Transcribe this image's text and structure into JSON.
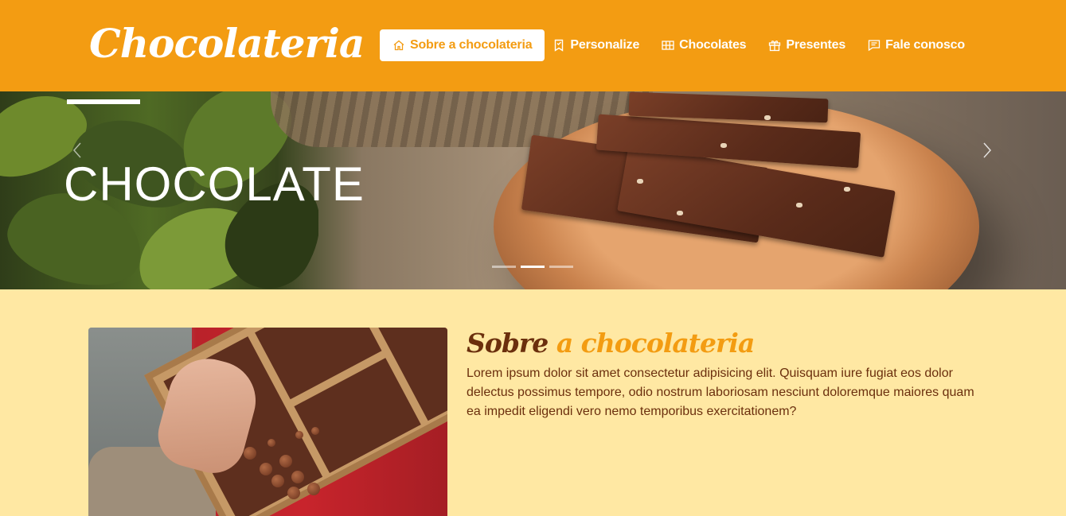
{
  "brand": {
    "logo": "Chocolateria"
  },
  "nav": {
    "items": [
      {
        "label": "Sobre a chocolateria",
        "icon": "home-icon",
        "active": true
      },
      {
        "label": "Personalize",
        "icon": "bookmark-icon",
        "active": false
      },
      {
        "label": "Chocolates",
        "icon": "grid-icon",
        "active": false
      },
      {
        "label": "Presentes",
        "icon": "gift-icon",
        "active": false
      },
      {
        "label": "Fale conosco",
        "icon": "chat-icon",
        "active": false
      }
    ]
  },
  "hero": {
    "title": "CHOCOLATE",
    "slides": 3,
    "active_slide": 2,
    "prev_icon": "chevron-left-icon",
    "next_icon": "chevron-right-icon"
  },
  "about": {
    "title_part1": "Sobre",
    "title_part2": "a chocolateria",
    "text": "Lorem ipsum dolor sit amet consectetur adipisicing elit. Quisquam iure fugiat eos dolor delectus possimus tempore, odio nostrum laboriosam nesciunt doloremque maiores quam ea impedit eligendi vero nemo temporibus exercitationem?"
  },
  "colors": {
    "accent": "#f39c12",
    "background": "#ffe8a3",
    "text_brown": "#6b2f0d"
  }
}
